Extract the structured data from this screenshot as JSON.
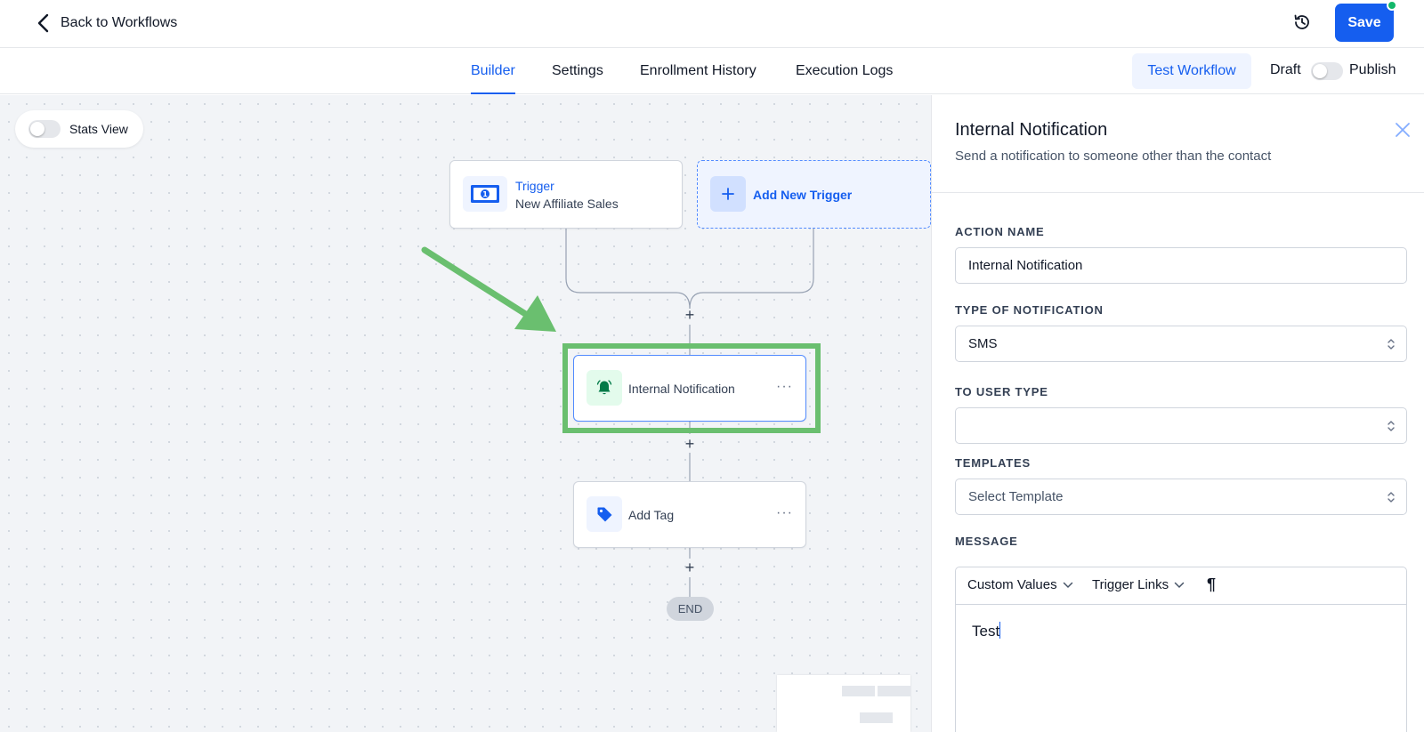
{
  "topbar": {
    "back_label": "Back to Workflows",
    "save_label": "Save"
  },
  "tabs": [
    {
      "label": "Builder",
      "active": true
    },
    {
      "label": "Settings",
      "active": false
    },
    {
      "label": "Enrollment History",
      "active": false
    },
    {
      "label": "Execution Logs",
      "active": false
    }
  ],
  "tabbar_actions": {
    "test_label": "Test Workflow",
    "draft_label": "Draft",
    "publish_label": "Publish",
    "published": false
  },
  "canvas": {
    "stats_label": "Stats View",
    "stats_enabled": false,
    "trigger": {
      "title": "Trigger",
      "subtitle": "New Affiliate Sales",
      "icon": "money-icon"
    },
    "add_trigger_label": "Add New Trigger",
    "nodes": [
      {
        "label": "Internal Notification",
        "icon": "bell-icon",
        "selected": true
      },
      {
        "label": "Add Tag",
        "icon": "tag-icon",
        "selected": false
      }
    ],
    "plus_symbol": "+",
    "menu_symbol": "···",
    "end_label": "END"
  },
  "panel": {
    "title": "Internal Notification",
    "subtitle": "Send a notification to someone other than the contact",
    "action_name_label": "ACTION NAME",
    "action_name_value": "Internal Notification",
    "type_label": "TYPE OF NOTIFICATION",
    "type_value": "SMS",
    "user_type_label": "TO USER TYPE",
    "user_type_value": "",
    "templates_label": "TEMPLATES",
    "templates_value": "Select Template",
    "message_label": "MESSAGE",
    "toolbar": {
      "custom_values": "Custom Values",
      "trigger_links": "Trigger Links",
      "paragraph_symbol": "¶"
    },
    "message_value": "Test"
  },
  "colors": {
    "primary": "#155eef",
    "highlight": "#6abf6f",
    "success": "#12b76a",
    "canvas_bg": "#f2f4f7"
  }
}
